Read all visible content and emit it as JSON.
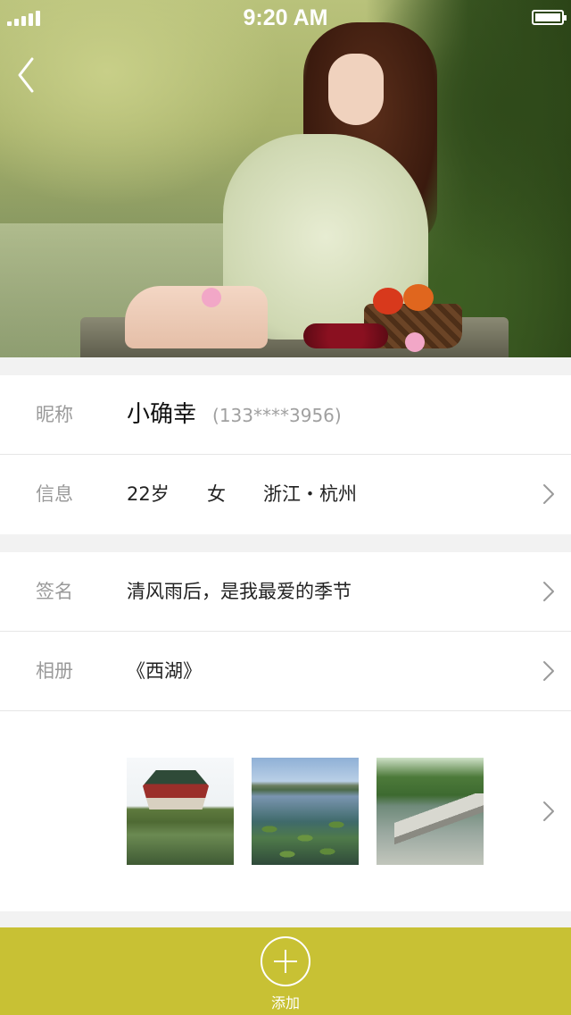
{
  "status_bar": {
    "time": "9:20 AM",
    "signal_icon": "signal-bars-icon",
    "battery_icon": "battery-full-icon"
  },
  "header": {
    "back_icon": "chevron-left-icon"
  },
  "profile": {
    "nickname_label": "昵称",
    "nickname": "小确幸",
    "phone": "(133****3956)",
    "info_label": "信息",
    "age": "22岁",
    "gender": "女",
    "location": "浙江・杭州",
    "signature_label": "签名",
    "signature": "清风雨后，是我最爱的季节",
    "album_label": "相册",
    "album_name": "《西湖》"
  },
  "bottom_bar": {
    "add_label": "添加",
    "color": "#c8c134",
    "add_icon": "plus-circle-icon"
  }
}
